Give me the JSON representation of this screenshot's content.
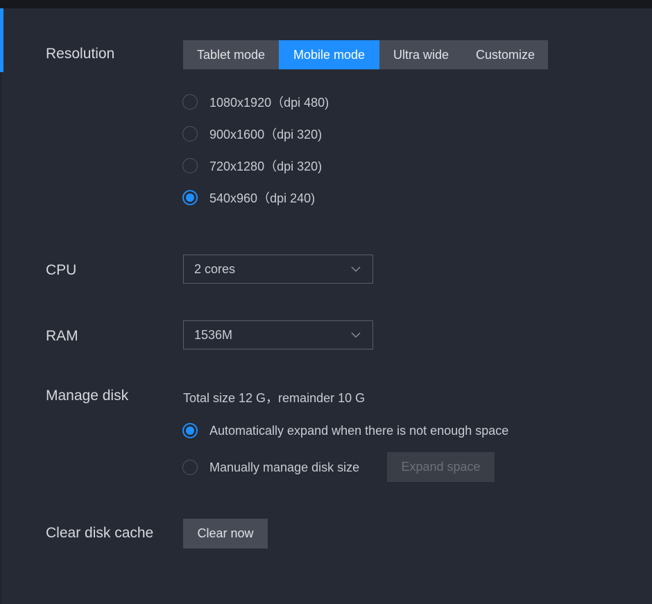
{
  "resolution": {
    "label": "Resolution",
    "modes": [
      "Tablet mode",
      "Mobile mode",
      "Ultra wide",
      "Customize"
    ],
    "active_mode": "Mobile mode",
    "options": [
      {
        "text": "1080x1920（dpi 480)",
        "checked": false
      },
      {
        "text": "900x1600（dpi 320)",
        "checked": false
      },
      {
        "text": "720x1280（dpi 320)",
        "checked": false
      },
      {
        "text": "540x960（dpi 240)",
        "checked": true
      }
    ]
  },
  "cpu": {
    "label": "CPU",
    "value": "2 cores"
  },
  "ram": {
    "label": "RAM",
    "value": "1536M"
  },
  "disk": {
    "label": "Manage disk",
    "info": "Total size 12 G，remainder 10 G",
    "auto_option": "Automatically expand when there is not enough space",
    "manual_option": "Manually manage disk size",
    "expand_button": "Expand space",
    "auto_checked": true
  },
  "cache": {
    "label": "Clear disk cache",
    "button": "Clear now"
  },
  "colors": {
    "accent": "#1f8fff",
    "background": "#262a34",
    "segment_bg": "#474b56",
    "text": "#c9ccd2"
  },
  "icons": {
    "dropdown": "chevron-down-icon"
  }
}
